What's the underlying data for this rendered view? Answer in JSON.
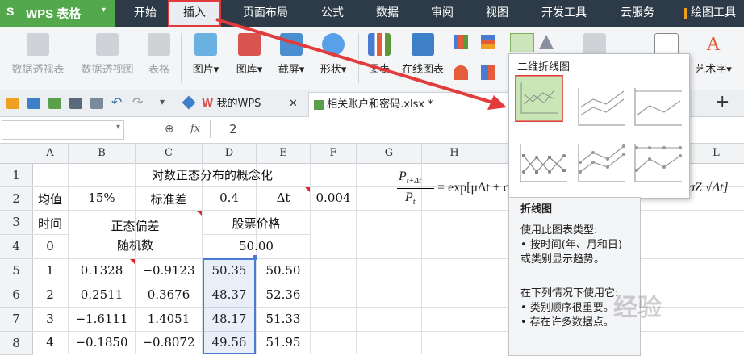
{
  "app": {
    "logo": "S",
    "name": "WPS 表格"
  },
  "menu": [
    "开始",
    "插入",
    "页面布局",
    "公式",
    "数据",
    "审阅",
    "视图",
    "开发工具",
    "云服务",
    "绘图工具"
  ],
  "ribbon": {
    "pivot_table": "数据透视表",
    "pivot_chart": "数据透视图",
    "table": "表格",
    "picture": "图片",
    "gallery": "图库",
    "screenshot": "截屏",
    "shape": "形状",
    "chart": "图表",
    "online_chart": "在线图表",
    "wordart": "艺术字"
  },
  "tabs": {
    "my_wps": "我的WPS",
    "file": "相关账户和密码.xlsx *",
    "add": "+"
  },
  "formula_bar": {
    "fx": "fx",
    "value": "2"
  },
  "columns": [
    "A",
    "B",
    "C",
    "D",
    "E",
    "F",
    "G",
    "H",
    "L"
  ],
  "rows": [
    "1",
    "2",
    "3",
    "4",
    "5",
    "6",
    "7",
    "8"
  ],
  "sheet": {
    "title": "对数正态分布的概念化",
    "r2": {
      "a": "均值",
      "b": "15%",
      "c": "标准差",
      "d": "0.4",
      "e": "Δt",
      "f": "0.004"
    },
    "r3": {
      "a": "时间",
      "bc": "正态偏差",
      "de": "股票价格"
    },
    "r4": {
      "a": "0",
      "bc": "随机数",
      "de": "50.00"
    },
    "data": [
      {
        "a": "1",
        "b": "0.1328",
        "c": "−0.9123",
        "d": "50.35",
        "e": "50.50"
      },
      {
        "a": "2",
        "b": "0.2511",
        "c": "0.3676",
        "d": "48.37",
        "e": "52.36"
      },
      {
        "a": "3",
        "b": "−1.6111",
        "c": "1.4051",
        "d": "48.17",
        "e": "51.33"
      },
      {
        "a": "4",
        "b": "−0.1850",
        "c": "−0.8072",
        "d": "49.56",
        "e": "51.95"
      }
    ]
  },
  "formula": {
    "lhs_num": "P",
    "lhs_num_sub": "t+Δt",
    "lhs_den": "P",
    "lhs_den_sub": "t",
    "rhs": "= exp[μΔt + σZ",
    "rhs_tail": "σZ √Δt]"
  },
  "popup": {
    "title": "二维折线图"
  },
  "tooltip": {
    "title": "折线图",
    "line1": "使用此图表类型:",
    "line2": "• 按时间(年、月和日)",
    "line3": "或类别显示趋势。",
    "line4": "在下列情况下使用它:",
    "line5": "• 类别顺序很重要。",
    "line6": "• 存在许多数据点。"
  },
  "watermark": "经验",
  "colors": {
    "menubar": "#2d3a47",
    "app_green": "#52a84a",
    "highlight_red": "#e23b3b",
    "selection_blue": "#4a7bd0",
    "selected_thumb": "#c9e7b6"
  }
}
